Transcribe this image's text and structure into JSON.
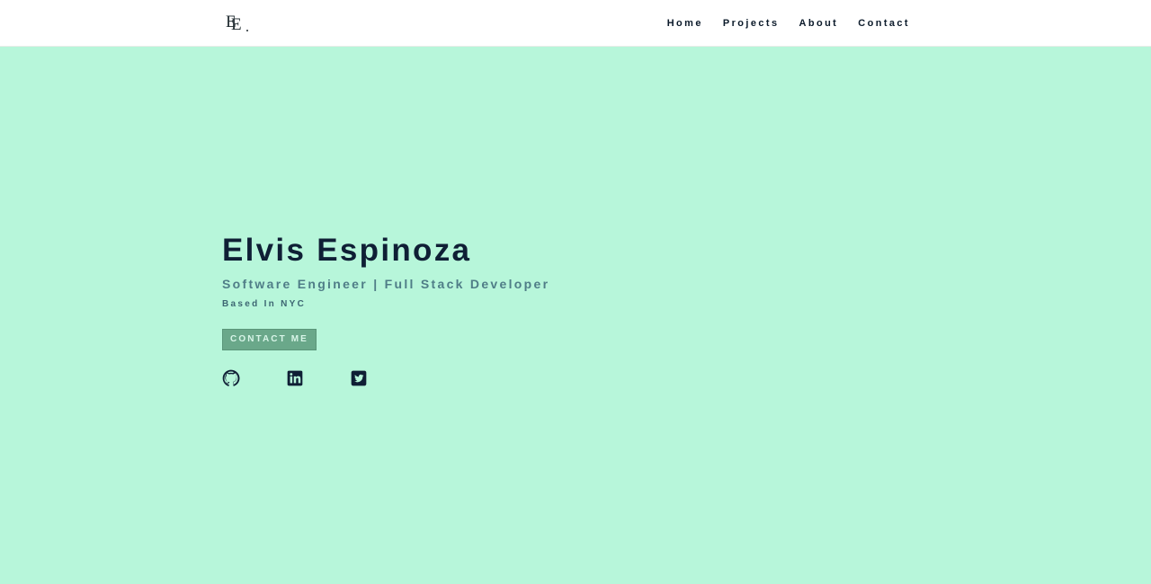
{
  "header": {
    "logo": {
      "line1": "E",
      "line2": "E"
    },
    "nav": [
      {
        "label": "Home"
      },
      {
        "label": "Projects"
      },
      {
        "label": "About"
      },
      {
        "label": "Contact"
      }
    ]
  },
  "hero": {
    "name": "Elvis Espinoza",
    "subtitle": "Software Engineer | Full Stack Developer",
    "location": "Based In NYC",
    "cta_label": "CONTACT ME"
  },
  "social": [
    {
      "icon": "github-icon"
    },
    {
      "icon": "linkedin-icon"
    },
    {
      "icon": "twitter-icon"
    }
  ],
  "colors": {
    "background": "#b7f6da",
    "header_bg": "#ffffff",
    "name": "#0f1f35",
    "subtitle": "#4f7d87",
    "cta_bg": "#6aa88a",
    "cta_text": "#d8f5e8",
    "icons": "#0f1f35"
  }
}
